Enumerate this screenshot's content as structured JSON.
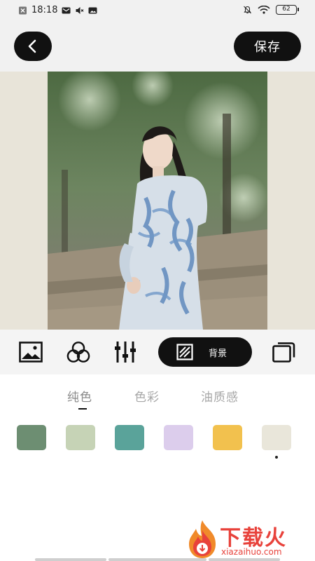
{
  "status_bar": {
    "time": "18:18",
    "battery": "62",
    "left_icons": [
      "close-box-icon",
      "mail-icon",
      "mute-icon",
      "image-icon"
    ],
    "right_icons": [
      "bell-off-icon",
      "wifi-icon"
    ]
  },
  "header": {
    "back_icon": "chevron-left-icon",
    "save_label": "保存"
  },
  "toolbar": {
    "tools": [
      "image-icon",
      "circles-filter-icon",
      "sliders-adjust-icon"
    ],
    "background_button_label": "背景",
    "background_button_icon": "hatch-square-icon",
    "layers_icon": "layers-icon"
  },
  "tabs": {
    "items": [
      {
        "label": "纯色",
        "selected": true
      },
      {
        "label": "色彩",
        "selected": false
      },
      {
        "label": "油质感",
        "selected": false
      }
    ]
  },
  "swatches": {
    "colors": [
      "#6d8e72",
      "#c6d3b6",
      "#5aa39a",
      "#dccdec",
      "#f2c14e",
      "#e9e6da"
    ],
    "selected_index": 5
  },
  "watermark": {
    "brand": "下载火",
    "url": "xiazaihuo.com"
  },
  "colors": {
    "accent": "#111111",
    "canvas_bg": "#e8e4d9",
    "brand_red": "#e8423b"
  }
}
